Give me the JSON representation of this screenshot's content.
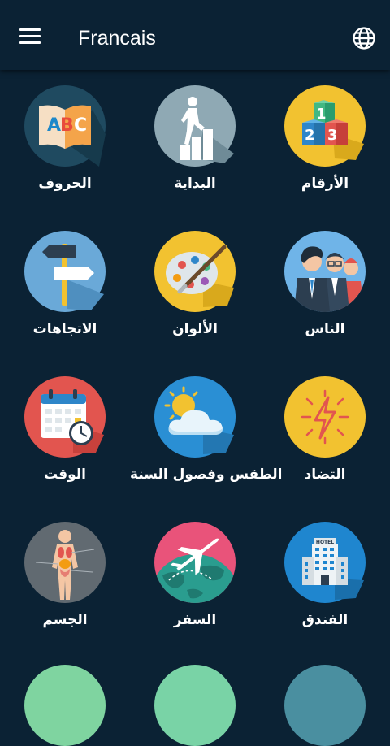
{
  "app_bar": {
    "title": "Francais",
    "menu_icon": "hamburger-menu-icon",
    "language_icon": "globe-icon"
  },
  "categories": [
    {
      "label": "الحروف",
      "icon": "alphabet-book-icon",
      "color": "#1f4a60"
    },
    {
      "label": "البداية",
      "icon": "climbing-stairs-icon",
      "color": "#8fa9b4"
    },
    {
      "label": "الأرقام",
      "icon": "number-blocks-icon",
      "color": "#f2c230"
    },
    {
      "label": "الاتجاهات",
      "icon": "direction-signpost-icon",
      "color": "#6aa9d8"
    },
    {
      "label": "الألوان",
      "icon": "paint-palette-icon",
      "color": "#f2c230"
    },
    {
      "label": "الناس",
      "icon": "people-group-icon",
      "color": "#6fb4e8"
    },
    {
      "label": "الوقت",
      "icon": "calendar-clock-icon",
      "color": "#e2554f"
    },
    {
      "label": "الطقس وفصول السنة",
      "icon": "sun-cloud-icon",
      "color": "#2a8fd4"
    },
    {
      "label": "التضاد",
      "icon": "lightning-icon",
      "color": "#f2c230"
    },
    {
      "label": "الجسم",
      "icon": "human-body-icon",
      "color": "#616a71"
    },
    {
      "label": "السفر",
      "icon": "airplane-globe-icon",
      "color": "#e9537a"
    },
    {
      "label": "الفندق",
      "icon": "hotel-building-icon",
      "color": "#1f86cf"
    }
  ],
  "partial_row_colors": [
    "#7fd4a0",
    "#79d3a6",
    "#4a8fa0"
  ]
}
